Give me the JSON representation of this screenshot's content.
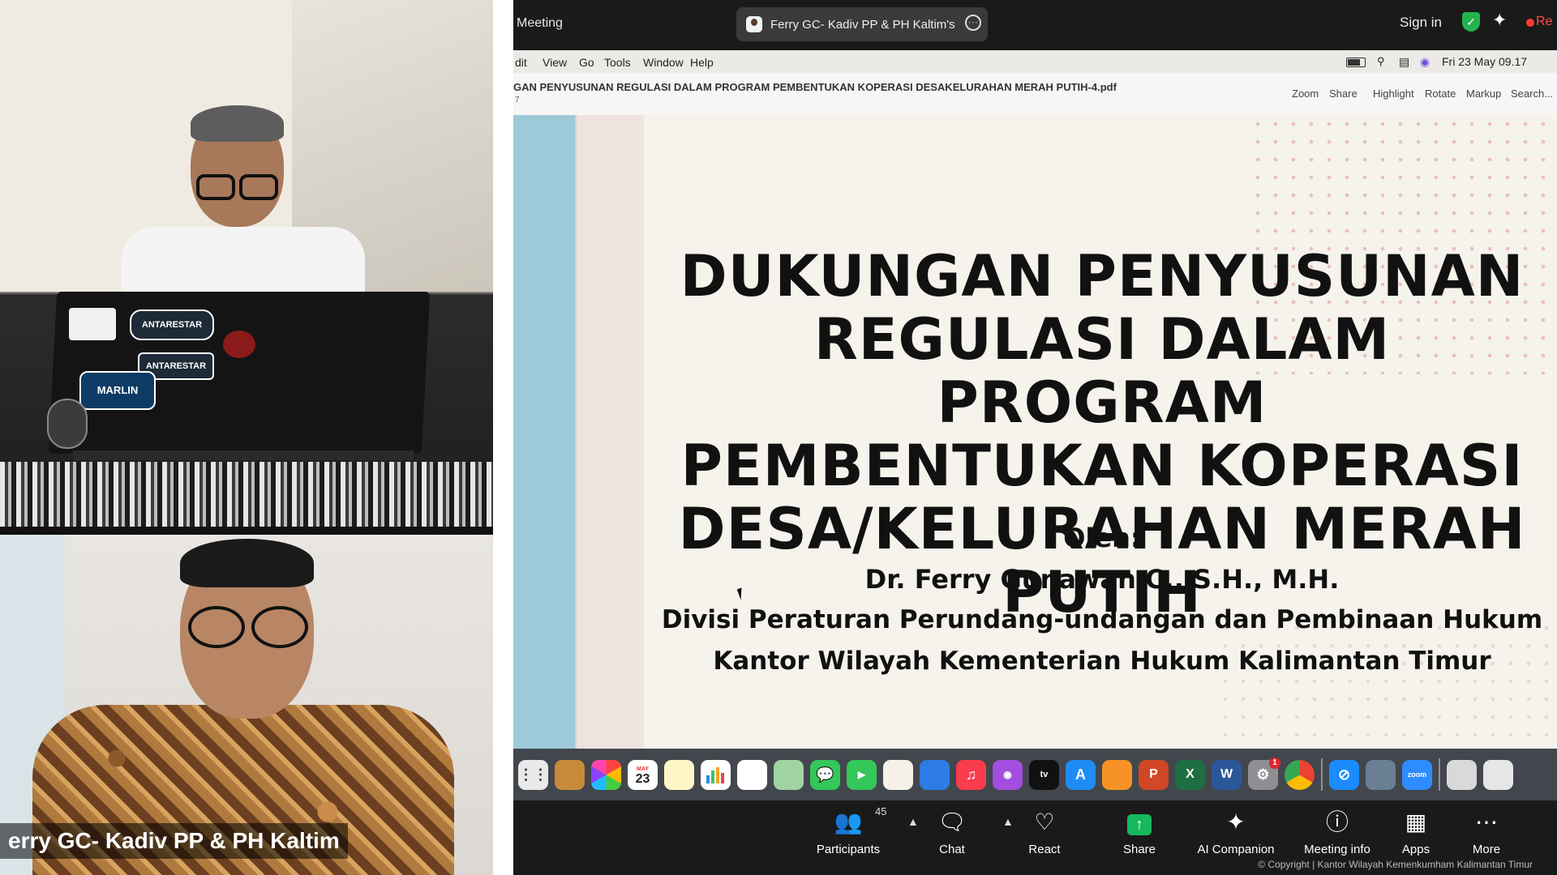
{
  "participants": {
    "bottom_tile_name": "erry GC- Kadiv PP & PH Kaltim"
  },
  "zoom_header": {
    "window_title": "Meeting",
    "active_speaker": "Ferry GC- Kadiv PP & PH Kaltim's",
    "sign_in": "Sign in",
    "recording_text": "Re"
  },
  "mac_menubar": {
    "menus": [
      "dit",
      "View",
      "Go",
      "Tools",
      "Window",
      "Help"
    ],
    "datetime": "Fri 23 May  09.17"
  },
  "preview": {
    "doc_title": "GAN PENYUSUNAN REGULASI DALAM PROGRAM PEMBENTUKAN KOPERASI DESAKELURAHAN MERAH PUTIH-4.pdf",
    "page_indicator": "7",
    "buttons": [
      "Zoom",
      "Share",
      "Highlight",
      "Rotate",
      "Markup",
      "Search..."
    ]
  },
  "slide": {
    "title_lines": [
      "DUKUNGAN PENYUSUNAN",
      "REGULASI DALAM PROGRAM",
      "PEMBENTUKAN KOPERASI",
      "DESA/KELURAHAN MERAH PUTIH"
    ],
    "oleh": "Oleh:",
    "author": "Dr. Ferry Gunawan C., S.H., M.H.",
    "division": "Divisi Peraturan Perundang-undangan dan Pembinaan Hukum",
    "office": "Kantor Wilayah Kementerian Hukum Kalimantan Timur"
  },
  "dock": {
    "calendar_month": "MAY",
    "calendar_day": "23",
    "zoom_label": "zoom",
    "settings_badge": "1"
  },
  "controls": {
    "participants_label": "Participants",
    "participants_count": "45",
    "chat_label": "Chat",
    "react_label": "React",
    "share_label": "Share",
    "ai_label": "AI Companion",
    "info_label": "Meeting info",
    "apps_label": "Apps",
    "more_label": "More"
  },
  "copyright": "© Copyright | Kantor Wilayah Kemenkumham Kalimantan Timur",
  "colors": {
    "zoom_bg": "#1a1a1a",
    "share_green": "#17b85e",
    "record_red": "#ff3b30",
    "slide_blue_band": "#9ec9d9"
  }
}
